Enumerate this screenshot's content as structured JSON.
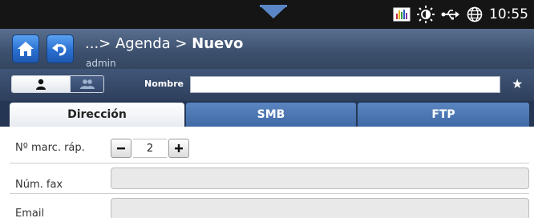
{
  "status_bar": {
    "clock": "10:55",
    "icons": [
      "chart-icon",
      "sun-icon",
      "usb-icon",
      "globe-icon",
      "pull-down-arrow-icon"
    ]
  },
  "header": {
    "breadcrumb_prefix": "...> Agenda > ",
    "breadcrumb_current": "Nuevo",
    "user": "admin",
    "buttons": [
      "home-icon",
      "back-icon"
    ]
  },
  "toolbar": {
    "mode_toggle": [
      "person-icon",
      "group-icon"
    ],
    "nombre_label": "Nombre",
    "nombre_value": "",
    "favorite_icon": "star-icon"
  },
  "tabs": [
    {
      "label": "Dirección",
      "active": true
    },
    {
      "label": "SMB",
      "active": false
    },
    {
      "label": "FTP",
      "active": false
    }
  ],
  "form": {
    "speed_dial_label": "Nº marc. ráp.",
    "speed_dial_value": "2",
    "fax_label": "Núm. fax",
    "fax_value": "",
    "email_label": "Email",
    "email_value": ""
  },
  "colors": {
    "accent": "#2a6fd0",
    "tab_active": "#ffffff",
    "tab_inactive": "#4f7ab5",
    "header": "#3c4f6d"
  }
}
